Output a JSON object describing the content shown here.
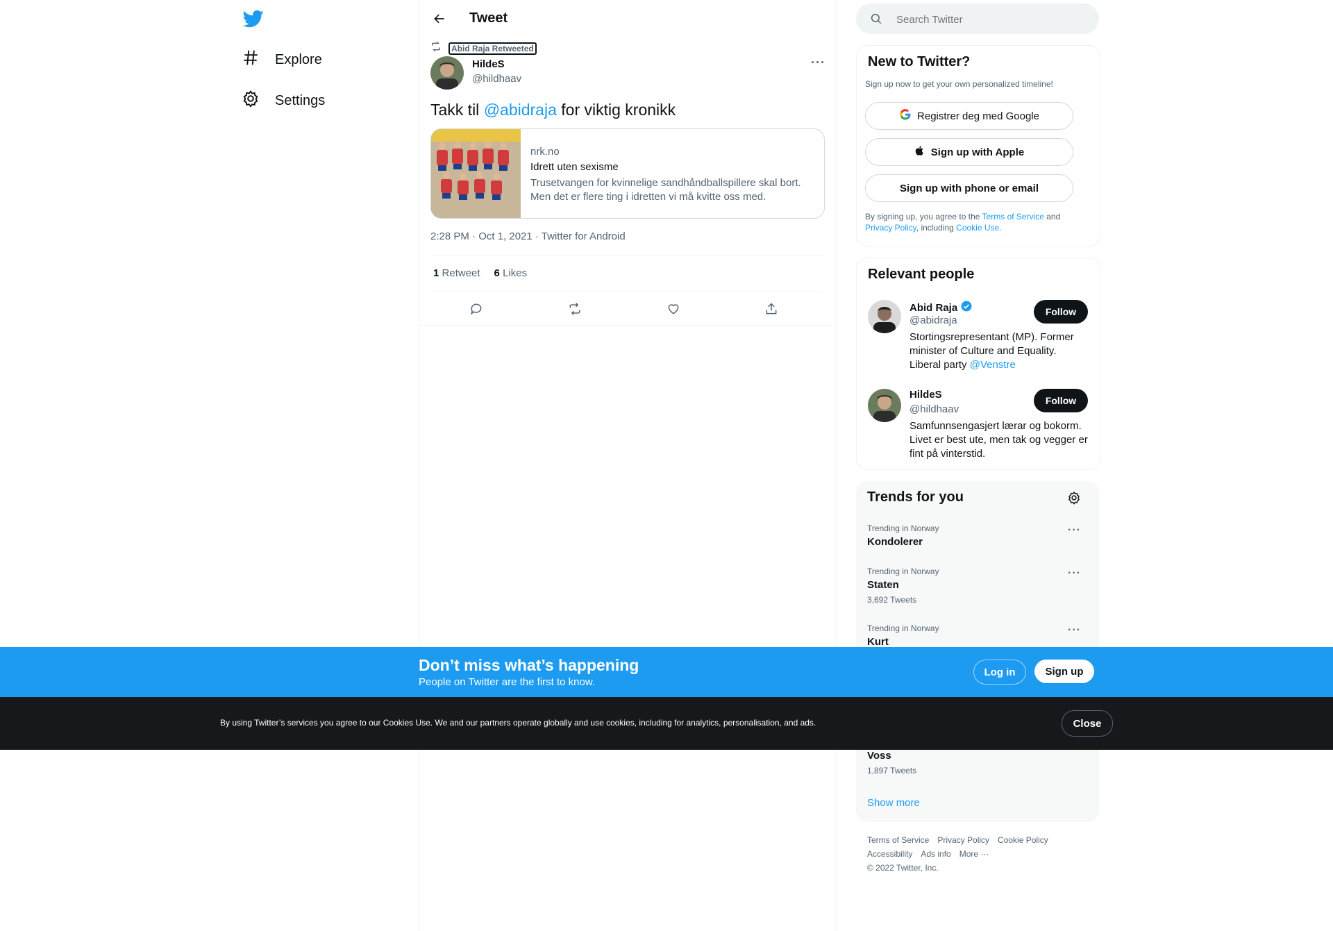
{
  "nav": {
    "logo_icon": "twitter-bird-icon",
    "items": [
      {
        "label": "Explore",
        "icon": "hashtag-icon"
      },
      {
        "label": "Settings",
        "icon": "gear-icon"
      }
    ]
  },
  "header": {
    "title": "Tweet",
    "back_icon": "arrow-left-icon"
  },
  "tweet": {
    "retweeted_by": "Abid Raja Retweeted",
    "author_name": "HildeS",
    "author_handle": "@hildhaav",
    "text_prefix": "Takk til ",
    "text_mention": "@abidraja",
    "text_suffix": " for viktig kronikk",
    "card": {
      "domain": "nrk.no",
      "title": "Idrett uten sexisme",
      "description": "Trusetvangen for kvinnelige sandhåndballspillere skal bort. Men det er flere ting i idretten vi må kvitte oss med."
    },
    "meta": "2:28 PM · Oct 1, 2021 · Twitter for Android",
    "retweet_count": "1",
    "retweet_label": "Retweet",
    "like_count": "6",
    "like_label": "Likes",
    "actions": [
      "reply-icon",
      "retweet-icon",
      "like-icon",
      "share-icon"
    ]
  },
  "search": {
    "placeholder": "Search Twitter"
  },
  "new_to_twitter": {
    "title": "New to Twitter?",
    "subtitle": "Sign up now to get your own personalized timeline!",
    "google_label": "Registrer deg med Google",
    "apple_label": "Sign up with Apple",
    "phone_label": "Sign up with phone or email",
    "legal_1": "By signing up, you agree to the ",
    "tos_link": "Terms of Service",
    "legal_2": " and ",
    "privacy_link": "Privacy Policy",
    "legal_3": ", including ",
    "cookie_link": "Cookie Use."
  },
  "relevant_people": {
    "title": "Relevant people",
    "people": [
      {
        "name": "Abid Raja",
        "handle": "@abidraja",
        "verified": true,
        "bio_text": "Stortingsrepresentant (MP). Former minister of Culture and Equality. Liberal party ",
        "bio_mention": "@Venstre",
        "follow_label": "Follow"
      },
      {
        "name": "HildeS",
        "handle": "@hildhaav",
        "verified": false,
        "bio_text": "Samfunnsengasjert lærar og bokorm. Livet er best ute, men tak og vegger er fint på vinterstid.",
        "follow_label": "Follow"
      }
    ]
  },
  "trends": {
    "title": "Trends for you",
    "items": [
      {
        "meta": "Trending in Norway",
        "name": "Kondolerer",
        "count": ""
      },
      {
        "meta": "Trending in Norway",
        "name": "Staten",
        "count": "3,692 Tweets"
      },
      {
        "meta": "Trending in Norway",
        "name": "Kurt",
        "count": ""
      },
      {
        "meta": "",
        "name": "Voss",
        "count": "1,897 Tweets"
      }
    ],
    "show_more": "Show more"
  },
  "footer": {
    "row1": [
      "Terms of Service",
      "Privacy Policy",
      "Cookie Policy"
    ],
    "row2": [
      "Accessibility",
      "Ads info",
      "More ···"
    ],
    "copyright": "© 2022 Twitter, Inc."
  },
  "signup_bar": {
    "title": "Don’t miss what’s happening",
    "subtitle": "People on Twitter are the first to know.",
    "login_label": "Log in",
    "signup_label": "Sign up"
  },
  "cookie_bar": {
    "text": "By using Twitter’s services you agree to our Cookies Use. We and our partners operate globally and use cookies, including for analytics, personalisation, and ads.",
    "close_label": "Close"
  },
  "colors": {
    "accent": "#1d9bf0",
    "text": "#0f1419",
    "muted": "#536471",
    "dark_bar": "#16181c"
  }
}
